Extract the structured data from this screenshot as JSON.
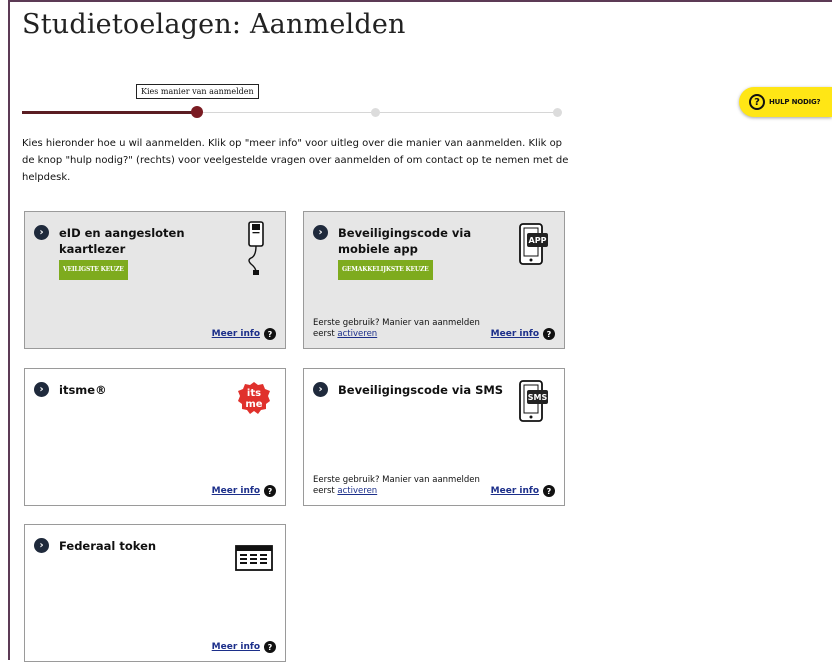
{
  "page": {
    "title": "Studietoelagen: Aanmelden"
  },
  "stepper": {
    "current_step_label": "Kies manier van aanmelden"
  },
  "help": {
    "label": "HULP NODIG?",
    "icon": "question-circle-icon"
  },
  "intro": "Kies hieronder hoe u wil aanmelden. Klik op \"meer info\" voor uitleg over die manier van aanmelden. Klik op de knop \"hulp nodig?\" (rechts) voor veelgestelde vragen over aanmelden of om contact op te nemen met de helpdesk.",
  "colors": {
    "accent_dark": "#5a1d22",
    "badge_green": "#7eab1e",
    "help_yellow": "#ffe615",
    "link_blue": "#1c2f8a"
  },
  "cards": [
    {
      "title": "eID en aangesloten kaartlezer",
      "badge": "VEILIGSTE KEUZE",
      "meer_info": "Meer info",
      "icon": "card-reader-icon",
      "selected": true
    },
    {
      "title": "Beveiligingscode via mobiele app",
      "badge": "GEMAKKELIJKSTE KEUZE",
      "meer_info": "Meer info",
      "first_use_text": "Eerste gebruik? Manier van aanmelden eerst",
      "activate_link": "activeren",
      "icon_text": "APP",
      "icon": "phone-app-icon",
      "selected": true
    },
    {
      "title": "itsme®",
      "meer_info": "Meer info",
      "icon_text_top": "its",
      "icon_text_bottom": "me",
      "icon": "itsme-logo-icon"
    },
    {
      "title": "Beveiligingscode via SMS",
      "meer_info": "Meer info",
      "first_use_text": "Eerste gebruik? Manier van aanmelden eerst",
      "activate_link": "activeren",
      "icon_text": "SMS",
      "icon": "phone-sms-icon"
    },
    {
      "title": "Federaal token",
      "meer_info": "Meer info",
      "icon": "token-grid-icon"
    }
  ]
}
